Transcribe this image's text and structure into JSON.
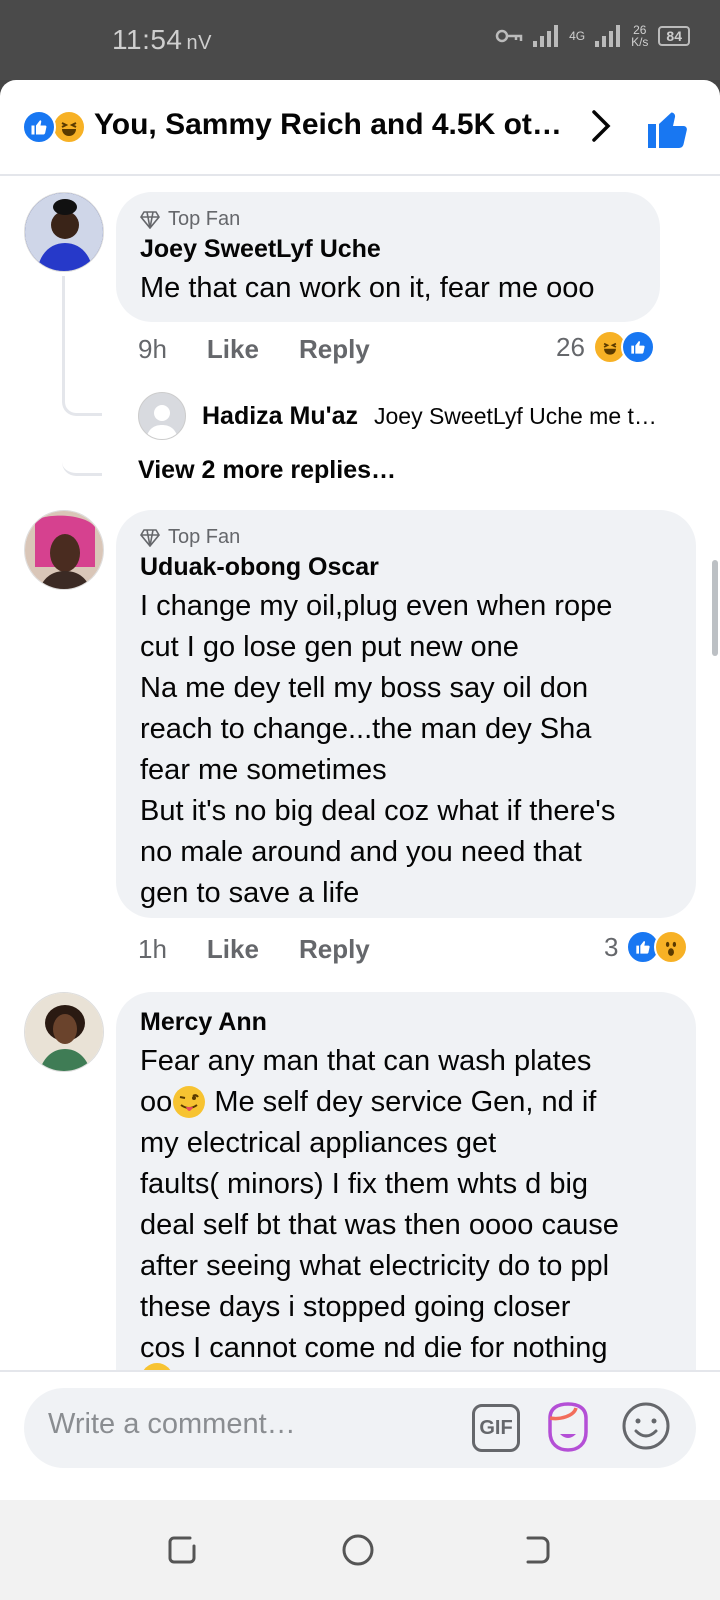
{
  "status": {
    "time": "11:54",
    "carrier": "nV",
    "net_top": "4G",
    "speed_num": "26",
    "speed_unit": "K/s",
    "battery": "84"
  },
  "header": {
    "title": "You, Sammy Reich and 4.5K ot…"
  },
  "comments": [
    {
      "badge": "Top Fan",
      "author": "Joey SweetLyf Uche",
      "text": "Me that can work on it, fear me ooo",
      "time": "9h",
      "like": "Like",
      "reply": "Reply",
      "reaction_count": "26",
      "reactions": [
        "haha",
        "like"
      ]
    },
    {
      "badge": "Top Fan",
      "author": "Uduak-obong Oscar",
      "lines": [
        "I change my oil,plug even when rope",
        "cut I go lose gen put new one",
        "Na me dey tell my boss say oil don",
        "reach to change...the man dey Sha",
        "fear me sometimes",
        "But it's no big deal coz what if there's",
        "no male around and you need that",
        "gen to save a life"
      ],
      "time": "1h",
      "like": "Like",
      "reply": "Reply",
      "reaction_count": "3",
      "reactions": [
        "like",
        "wow"
      ]
    },
    {
      "author": "Mercy Ann",
      "line1_a": "Fear any man that can wash plates",
      "line2_a": "oo",
      "line2_b": " Me self dey service Gen, nd if",
      "lines": [
        "my electrical appliances get",
        "faults( minors)  I fix them whts d big",
        "deal self bt that was then oooo cause",
        "after seeing what electricity do to ppl",
        "these days i stopped going closer",
        "cos I cannot come nd die for nothing"
      ]
    }
  ],
  "reply_preview": {
    "name": "Hadiza Mu'az",
    "text": "Joey SweetLyf Uche me t…"
  },
  "view_more": "View 2 more replies…",
  "composer": {
    "placeholder": "Write a comment…",
    "gif": "GIF"
  },
  "colors": {
    "brand_blue": "#1877f2",
    "haha_yellow": "#f7b125",
    "bubble_gray": "#f0f2f5"
  }
}
